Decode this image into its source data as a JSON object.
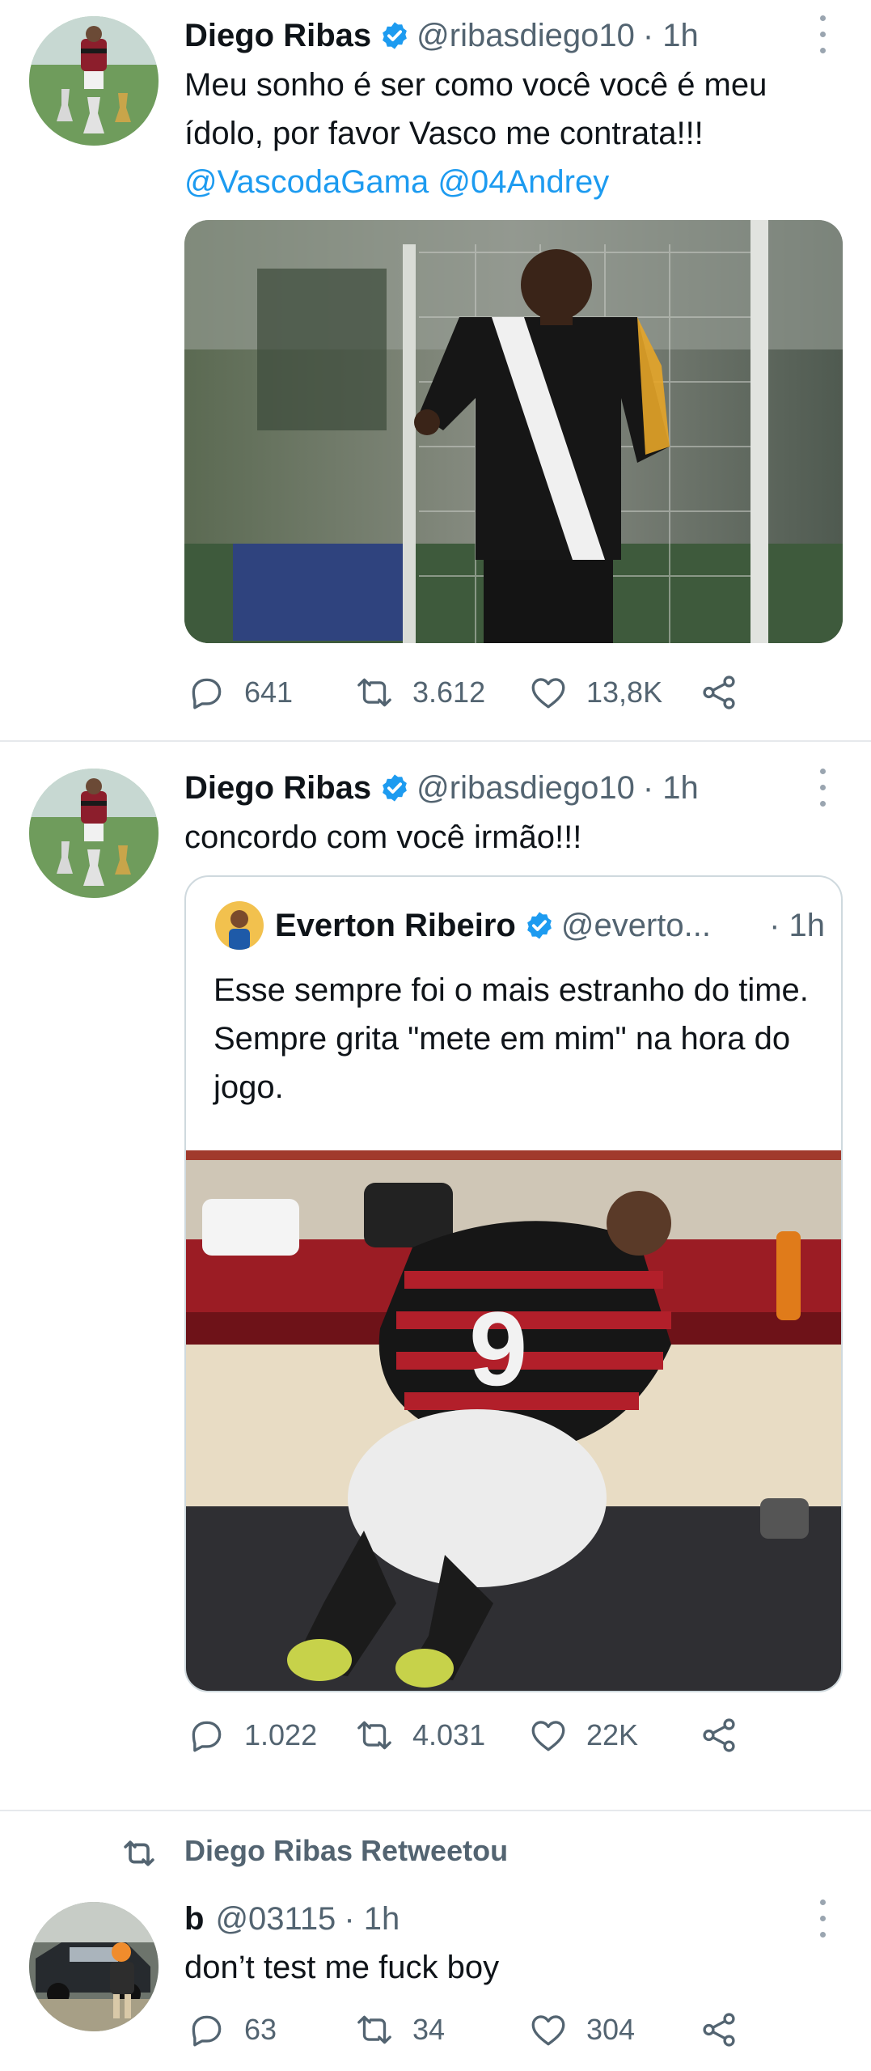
{
  "tweets": [
    {
      "author_name": "Diego Ribas",
      "handle": "@ribasdiego10",
      "time": "· 1h",
      "text": "Meu sonho é ser como você você é meu ídolo, por favor Vasco me contrata!!!",
      "mentions": [
        "@VascodaGama",
        "@04Andrey"
      ],
      "replies": "641",
      "retweets": "3.612",
      "likes": "13,8K",
      "avatar_icon": "trophies-photo",
      "media_icon": "vasco-player-photo"
    },
    {
      "author_name": "Diego Ribas",
      "handle": "@ribasdiego10",
      "time": "· 1h",
      "text": "concordo com você irmão!!!",
      "replies": "1.022",
      "retweets": "4.031",
      "likes": "22K",
      "quote": {
        "author_name": "Everton Ribeiro",
        "handle": "@everto...",
        "time": "· 1h",
        "text_line1": "Esse sempre foi o mais estranho do time.",
        "text_line2": "Sempre grita \"mete em mim\" na hora do jogo.",
        "media_icon": "locker-room-photo"
      }
    },
    {
      "retweet_label": "Diego Ribas Retweetou",
      "author_name": "b",
      "handle": "@03115",
      "time": "· 1h",
      "text": "don’t test me fuck boy",
      "replies": "63",
      "retweets": "34",
      "likes": "304",
      "avatar_icon": "police-car-photo"
    }
  ],
  "colors": {
    "accent": "#1d9bf0",
    "text": "#0f1419",
    "muted": "#536471",
    "divider": "#e6e9ec"
  }
}
